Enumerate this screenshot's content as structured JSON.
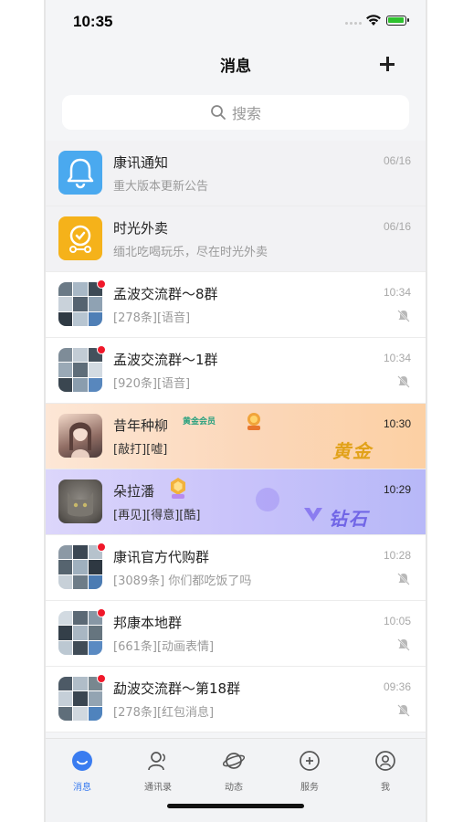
{
  "status": {
    "time": "10:35"
  },
  "nav": {
    "title": "消息"
  },
  "search": {
    "placeholder": "搜索"
  },
  "chats": [
    {
      "name": "康讯通知",
      "preview": "重大版本更新公告",
      "time": "06/16",
      "avatar": "bell-icon",
      "pinned": true
    },
    {
      "name": "时光外卖",
      "preview": "缅北吃喝玩乐，尽在时光外卖",
      "time": "06/16",
      "avatar": "delivery-icon",
      "pinned": true
    },
    {
      "name": "孟波交流群～8群",
      "preview": "[278条][语音]",
      "time": "10:34",
      "muted": true,
      "unread": true
    },
    {
      "name": "孟波交流群～1群",
      "preview": "[920条][语音]",
      "time": "10:34",
      "muted": true,
      "unread": true
    },
    {
      "name": "昔年种柳",
      "preview": "[敲打][嘘]",
      "time": "10:30",
      "badge": "黄金会员",
      "tier": "黄金",
      "vip": "gold"
    },
    {
      "name": "朵拉潘",
      "preview": "[再见][得意][酷]",
      "time": "10:29",
      "tier": "钻石",
      "vip": "diamond"
    },
    {
      "name": "康讯官方代购群",
      "preview": "[3089条] 你们都吃饭了吗",
      "time": "10:28",
      "muted": true,
      "unread": true
    },
    {
      "name": "邦康本地群",
      "preview": "[661条][动画表情]",
      "time": "10:05",
      "muted": true,
      "unread": true
    },
    {
      "name": "勐波交流群～第18群",
      "preview": "[278条][红包消息]",
      "time": "09:36",
      "muted": true,
      "unread": true
    }
  ],
  "tabs": [
    {
      "label": "消息",
      "icon": "chat-icon",
      "active": true
    },
    {
      "label": "通讯录",
      "icon": "contacts-icon"
    },
    {
      "label": "动态",
      "icon": "planet-icon"
    },
    {
      "label": "服务",
      "icon": "service-icon"
    },
    {
      "label": "我",
      "icon": "profile-icon"
    }
  ],
  "colors": {
    "accent": "#3a7cf0",
    "unread": "#f0182a",
    "gold_start": "#fde7d6",
    "diamond_end": "#b7b8f8"
  }
}
